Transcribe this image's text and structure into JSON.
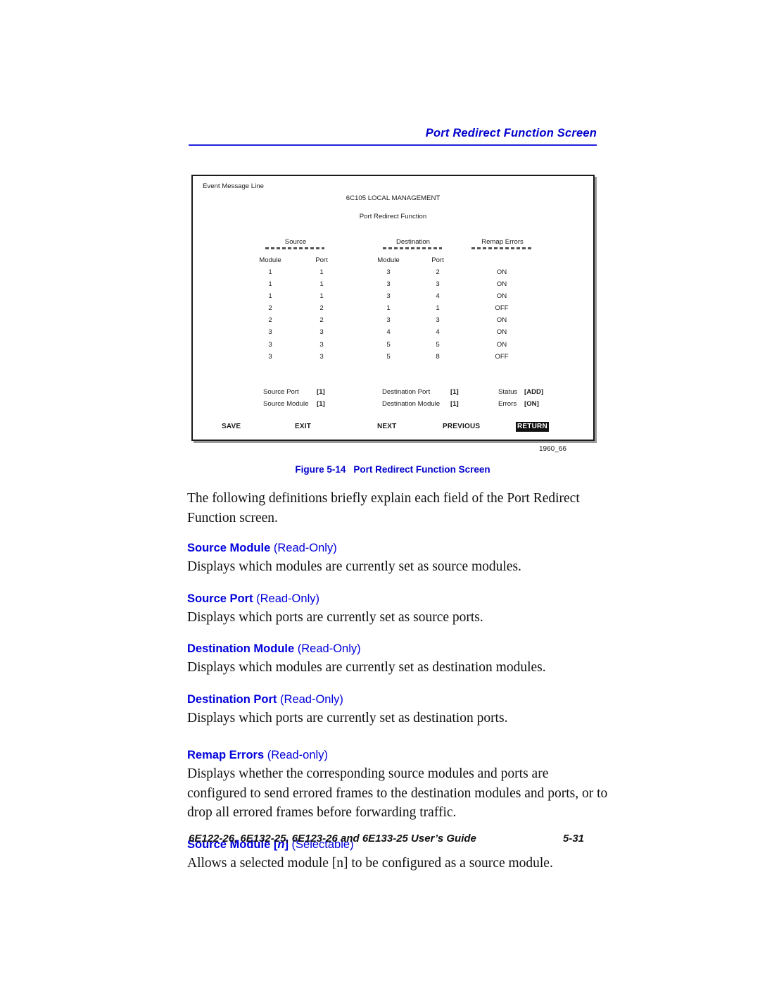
{
  "running_head": "Port Redirect Function Screen",
  "accent_color": "#0000cc",
  "rule_color": "#2222dd",
  "screen": {
    "event_message_line": "Event Message Line",
    "title": "6C105 LOCAL MANAGEMENT",
    "subtitle": "Port Redirect Function",
    "group_headers": [
      {
        "label": "Source"
      },
      {
        "label": "Destination"
      },
      {
        "label": "Remap Errors"
      }
    ],
    "column_headers": [
      "Module",
      "Port",
      "Module",
      "Port",
      ""
    ],
    "rows": [
      {
        "source_module": "1",
        "source_port": "1",
        "dest_module": "3",
        "dest_port": "2",
        "remap_errors": "ON"
      },
      {
        "source_module": "1",
        "source_port": "1",
        "dest_module": "3",
        "dest_port": "3",
        "remap_errors": "ON"
      },
      {
        "source_module": "1",
        "source_port": "1",
        "dest_module": "3",
        "dest_port": "4",
        "remap_errors": "ON"
      },
      {
        "source_module": "2",
        "source_port": "2",
        "dest_module": "1",
        "dest_port": "1",
        "remap_errors": "OFF"
      },
      {
        "source_module": "2",
        "source_port": "2",
        "dest_module": "3",
        "dest_port": "3",
        "remap_errors": "ON"
      },
      {
        "source_module": "3",
        "source_port": "3",
        "dest_module": "4",
        "dest_port": "4",
        "remap_errors": "ON"
      },
      {
        "source_module": "3",
        "source_port": "3",
        "dest_module": "5",
        "dest_port": "5",
        "remap_errors": "ON"
      },
      {
        "source_module": "3",
        "source_port": "3",
        "dest_module": "5",
        "dest_port": "8",
        "remap_errors": "OFF"
      }
    ],
    "fields": {
      "source_port_label": "Source Port",
      "source_port_value": "[1]",
      "source_module_label": "Source Module",
      "source_module_value": "[1]",
      "destination_port_label": "Destination Port",
      "destination_port_value": "[1]",
      "destination_module_label": "Destination Module",
      "destination_module_value": "[1]",
      "status_label": "Status",
      "status_value": "[ADD]",
      "errors_label": "Errors",
      "errors_value": "[ON]"
    },
    "commands": [
      {
        "label": "SAVE",
        "selected": false
      },
      {
        "label": "EXIT",
        "selected": false
      },
      {
        "label": "NEXT",
        "selected": false
      },
      {
        "label": "PREVIOUS",
        "selected": false
      },
      {
        "label": "RETURN",
        "selected": true
      }
    ],
    "figure_id": "1960_66"
  },
  "figure_caption": {
    "number": "Figure 5-14",
    "title": "Port Redirect Function Screen"
  },
  "body": {
    "intro": "The following definitions briefly explain each field of the Port Redirect Function screen.",
    "definitions": [
      {
        "term": "Source Module",
        "qualifier": "(Read-Only)",
        "text": "Displays which modules are currently set as source modules."
      },
      {
        "term": "Source Port",
        "qualifier": "(Read-Only)",
        "text": "Displays which ports are currently set as source ports."
      },
      {
        "term": "Destination Module",
        "qualifier": "(Read-Only)",
        "text": "Displays which modules are currently set as destination modules."
      },
      {
        "term": "Destination Port",
        "qualifier": "(Read-Only)",
        "text": "Displays which ports are currently set as destination ports."
      },
      {
        "term": "Remap Errors",
        "qualifier": "(Read-only)",
        "text": "Displays whether the corresponding source modules and ports are configured to send errored frames to the destination modules and ports, or to drop all errored frames before forwarding traffic."
      },
      {
        "term_prefix": "Source Module [",
        "term_italic": "n",
        "term_suffix": "]",
        "term": "Source Module [n]",
        "qualifier": "(Selectable)",
        "text": "Allows a selected module [n] to be configured as a source module."
      }
    ]
  },
  "footer": {
    "guide": "6E122-26, 6E132-25, 6E123-26 and 6E133-25 User’s Guide",
    "page": "5-31"
  }
}
